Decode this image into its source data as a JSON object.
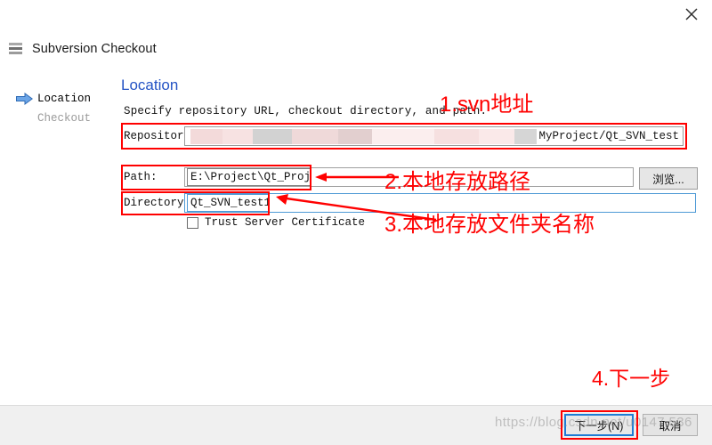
{
  "window": {
    "close_icon": "close-icon",
    "app_icon": "stack-icon",
    "title": "Subversion Checkout"
  },
  "sidebar": {
    "items": [
      {
        "label": "Location",
        "state": "active",
        "icon": "blue-arrow-icon"
      },
      {
        "label": "Checkout",
        "state": "inactive"
      }
    ]
  },
  "page": {
    "heading": "Location",
    "description": "Specify repository URL, checkout directory, and path.",
    "heading_color": "#2453c4"
  },
  "form": {
    "repository": {
      "label": "Repository:",
      "value_tail": "MyProject/Qt_SVN_test",
      "redacted": true
    },
    "path": {
      "label": "Path:",
      "value": "E:\\Project\\Qt_Project"
    },
    "directory": {
      "label": "Directory:",
      "value": "Qt_SVN_test1"
    },
    "trust_certificate": {
      "label": "Trust Server Certificate",
      "checked": false
    },
    "browse_button": "浏览..."
  },
  "footer": {
    "next_label": "下一步(N)",
    "cancel_label": "取消"
  },
  "annotations": {
    "color": "#ff0000",
    "items": [
      {
        "id": "a1",
        "text": "1.svn地址"
      },
      {
        "id": "a2",
        "text": "2.本地存放路径"
      },
      {
        "id": "a3",
        "text": "3.本地存放文件夹名称"
      },
      {
        "id": "a4",
        "text": "4.下一步"
      }
    ]
  },
  "watermark": {
    "text": "https://blog.csdn.net/u0147   536"
  }
}
